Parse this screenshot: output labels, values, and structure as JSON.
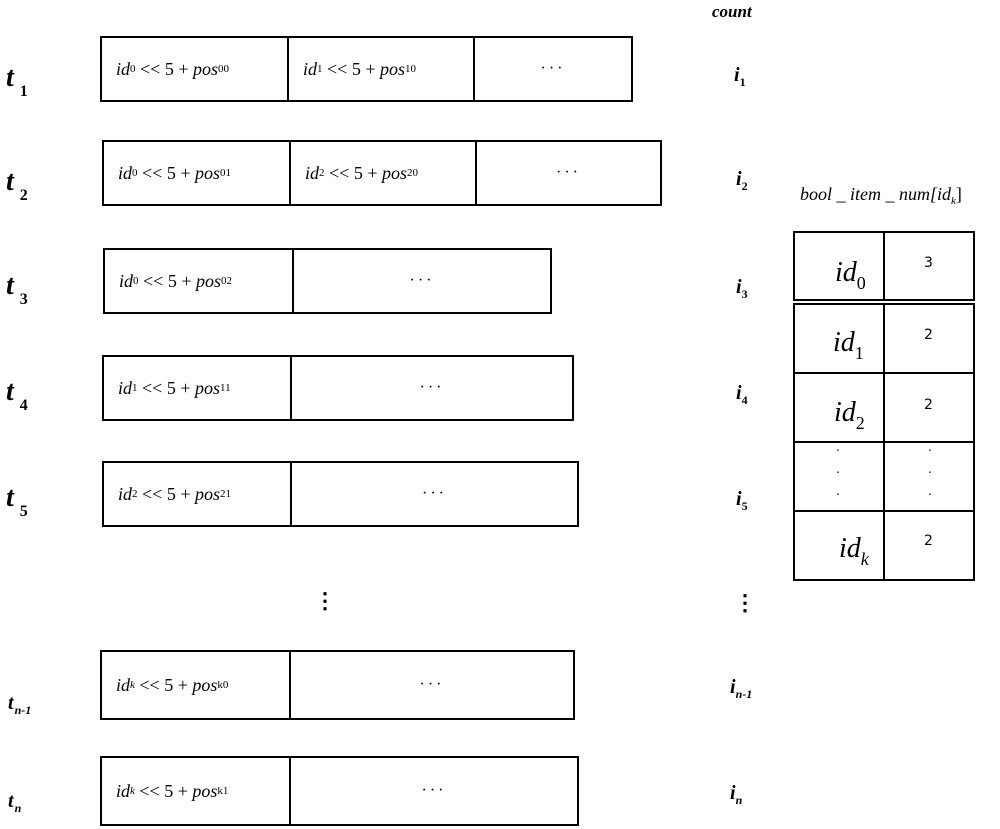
{
  "count_header": "count",
  "rows": [
    {
      "t": "t",
      "t_sub": "1",
      "cells": [
        {
          "id_sub": "0",
          "shift": "<< 5 +",
          "pos_sub": "00"
        },
        {
          "id_sub": "1",
          "shift": "<< 5 +",
          "pos_sub": "10"
        },
        {
          "ellipsis": "···"
        }
      ],
      "count": "i",
      "count_sub": "1"
    },
    {
      "t": "t",
      "t_sub": "2",
      "cells": [
        {
          "id_sub": "0",
          "shift": "<< 5 +",
          "pos_sub": "01"
        },
        {
          "id_sub": "2",
          "shift": "<< 5 +",
          "pos_sub": "20"
        },
        {
          "ellipsis": "···"
        }
      ],
      "count": "i",
      "count_sub": "2"
    },
    {
      "t": "t",
      "t_sub": "3",
      "cells": [
        {
          "id_sub": "0",
          "shift": "<< 5 +",
          "pos_sub": "02"
        },
        {
          "ellipsis": "···"
        }
      ],
      "count": "i",
      "count_sub": "3"
    },
    {
      "t": "t",
      "t_sub": "4",
      "cells": [
        {
          "id_sub": "1",
          "shift": "<< 5 +",
          "pos_sub": "11"
        },
        {
          "ellipsis": "···"
        }
      ],
      "count": "i",
      "count_sub": "4"
    },
    {
      "t": "t",
      "t_sub": "5",
      "cells": [
        {
          "id_sub": "2",
          "shift": "<< 5 +",
          "pos_sub": "21"
        },
        {
          "ellipsis": "···"
        }
      ],
      "count": "i",
      "count_sub": "5"
    },
    {
      "t": "t",
      "t_sub": "n-1",
      "cells": [
        {
          "id_sub": "k",
          "shift": "<< 5 +",
          "pos_sub": "k0"
        },
        {
          "ellipsis": "···"
        }
      ],
      "count": "i",
      "count_sub": "n-1"
    },
    {
      "t": "t",
      "t_sub": "n",
      "cells": [
        {
          "id_sub": "k",
          "shift": "<< 5 +",
          "pos_sub": "k1"
        },
        {
          "ellipsis": "···"
        }
      ],
      "count": "i",
      "count_sub": "n"
    }
  ],
  "expr": {
    "id": "id",
    "pos": "pos"
  },
  "vertical_ellipsis": "⋮",
  "table": {
    "title": "bool _ item _ num[id",
    "title_sub": "k",
    "title_close": "]",
    "rows": [
      {
        "id": "id",
        "sub": "0",
        "value": "3"
      },
      {
        "id": "id",
        "sub": "1",
        "value": "2"
      },
      {
        "id": "id",
        "sub": "2",
        "value": "2"
      },
      {
        "ellipsis": true
      },
      {
        "id": "id",
        "sub": "k",
        "value": "2"
      }
    ]
  }
}
